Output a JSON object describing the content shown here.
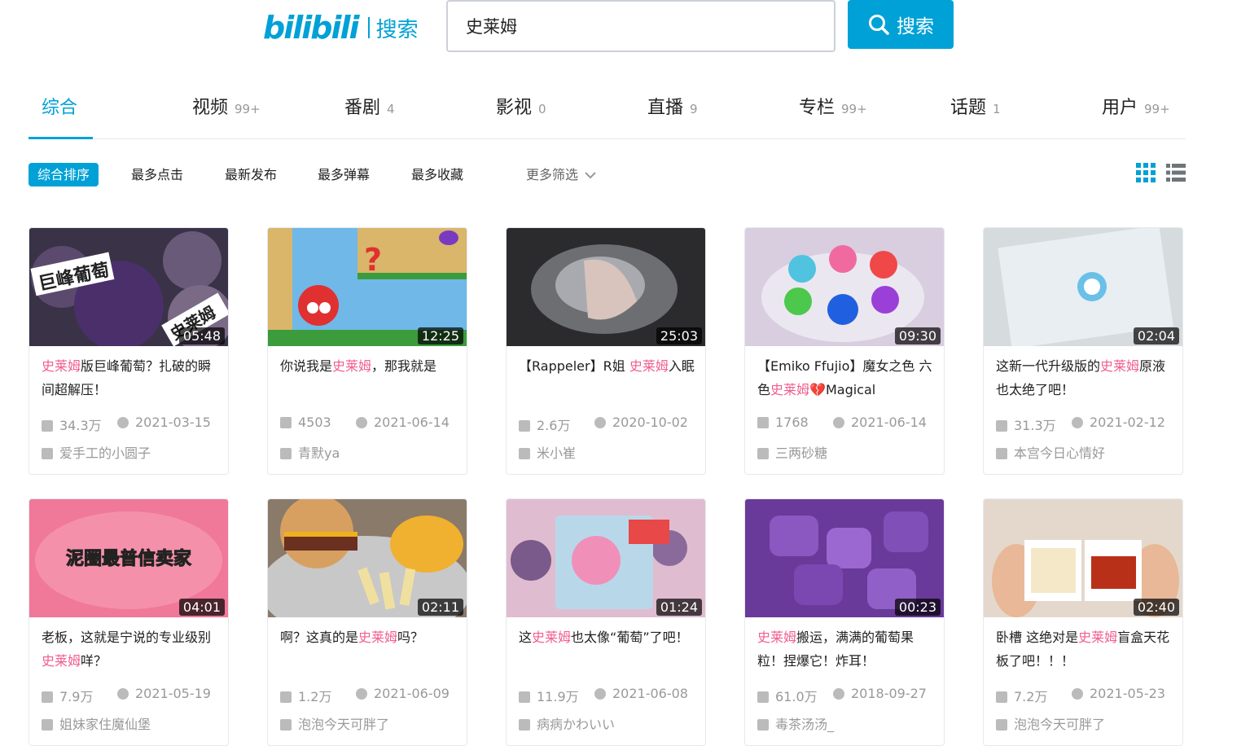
{
  "header": {
    "logo_text": "bilibili",
    "logo_search": "搜索",
    "search_value": "史莱姆",
    "search_button": "搜索"
  },
  "tabs": [
    {
      "label": "综合",
      "count": ""
    },
    {
      "label": "视频",
      "count": "99+"
    },
    {
      "label": "番剧",
      "count": "4"
    },
    {
      "label": "影视",
      "count": "0"
    },
    {
      "label": "直播",
      "count": "9"
    },
    {
      "label": "专栏",
      "count": "99+"
    },
    {
      "label": "话题",
      "count": "1"
    },
    {
      "label": "用户",
      "count": "99+"
    }
  ],
  "filters": [
    "综合排序",
    "最多点击",
    "最新发布",
    "最多弹幕",
    "最多收藏"
  ],
  "more_filter": "更多筛选",
  "accent_color": "#00a1d6",
  "highlight_color": "#f25d8e",
  "cards": [
    {
      "pre": "",
      "hl": "史莱姆",
      "post": "版巨峰葡萄？扎破的瞬间超解压！",
      "duration": "05:48",
      "views": "34.3万",
      "date": "2021-03-15",
      "up": "爱手工的小圆子"
    },
    {
      "pre": "你说我是",
      "hl": "史莱姆",
      "post": "，那我就是",
      "duration": "12:25",
      "views": "4503",
      "date": "2021-06-14",
      "up": "青默ya"
    },
    {
      "pre": "【Rappeler】R姐 ",
      "hl": "史莱姆",
      "post": "入眠",
      "duration": "25:03",
      "views": "2.6万",
      "date": "2020-10-02",
      "up": "米小崔"
    },
    {
      "pre": "【Emiko Ffujio】魔女之色 六色",
      "hl": "史莱姆",
      "post": "💔Magical",
      "duration": "09:30",
      "views": "1768",
      "date": "2021-06-14",
      "up": "三两砂糖"
    },
    {
      "pre": "这新一代升级版的",
      "hl": "史莱姆",
      "post": "原液也太绝了吧！",
      "duration": "02:04",
      "views": "31.3万",
      "date": "2021-02-12",
      "up": "本宫今日心情好"
    },
    {
      "pre": "老板，这就是宁说的专业级别",
      "hl": "史莱姆",
      "post": "咩？",
      "duration": "04:01",
      "views": "7.9万",
      "date": "2021-05-19",
      "up": "姐妹家住魔仙堡"
    },
    {
      "pre": "啊？这真的是",
      "hl": "史莱姆",
      "post": "吗？",
      "duration": "02:11",
      "views": "1.2万",
      "date": "2021-06-09",
      "up": "泡泡今天可胖了"
    },
    {
      "pre": "这",
      "hl": "史莱姆",
      "post": "也太像“葡萄”了吧！",
      "duration": "01:24",
      "views": "11.9万",
      "date": "2021-06-08",
      "up": "病病かわいい"
    },
    {
      "pre": "",
      "hl": "史莱姆",
      "post": "搬运，满满的葡萄果粒！捏爆它！炸耳！",
      "duration": "00:23",
      "views": "61.0万",
      "date": "2018-09-27",
      "up": "毒茶汤汤_"
    },
    {
      "pre": "卧槽 这绝对是",
      "hl": "史莱姆",
      "post": "盲盒天花板了吧！！！",
      "duration": "02:40",
      "views": "7.2万",
      "date": "2021-05-23",
      "up": "泡泡今天可胖了"
    }
  ]
}
